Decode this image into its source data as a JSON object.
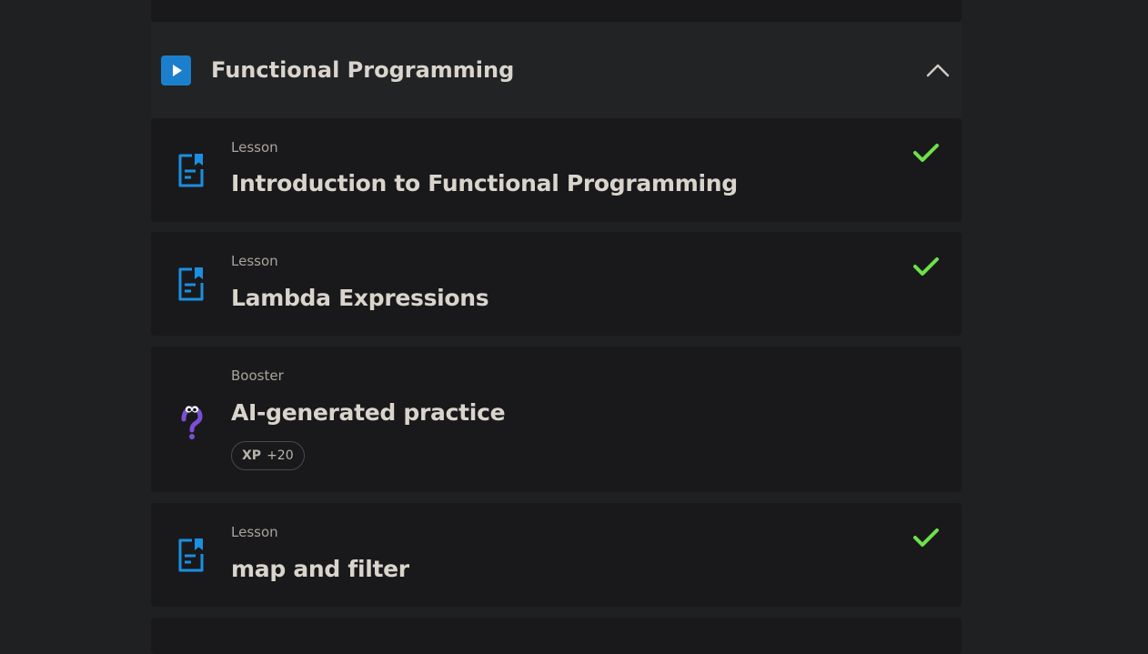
{
  "section": {
    "title": "Functional Programming",
    "icon": "play-icon",
    "accent_color": "#1b7fcc",
    "collapse_icon": "chevron-up-icon"
  },
  "items": [
    {
      "type": "Lesson",
      "title": "Introduction to Functional Programming",
      "icon": "lesson-document-icon",
      "completed": true
    },
    {
      "type": "Lesson",
      "title": "Lambda Expressions",
      "icon": "lesson-document-icon",
      "completed": true
    },
    {
      "type": "Booster",
      "title": "AI-generated practice",
      "icon": "question-mascot-icon",
      "xp_label": "XP",
      "xp_value": "+20"
    },
    {
      "type": "Lesson",
      "title": "map and filter",
      "icon": "lesson-document-icon",
      "completed": true
    }
  ],
  "colors": {
    "check": "#6ee04a",
    "lesson_icon": "#1b8fe0",
    "booster_icon": "#7a4fd6"
  }
}
